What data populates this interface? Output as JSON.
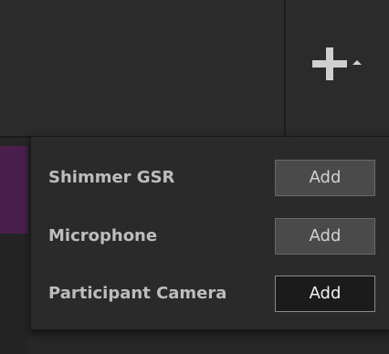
{
  "toolbar": {
    "add_menu_icon": "plus-icon",
    "caret_icon": "caret-up-icon"
  },
  "add_menu": {
    "items": [
      {
        "label": "Shimmer GSR",
        "button_label": "Add",
        "enabled": false
      },
      {
        "label": "Microphone",
        "button_label": "Add",
        "enabled": false
      },
      {
        "label": "Participant Camera",
        "button_label": "Add",
        "enabled": true
      }
    ]
  },
  "colors": {
    "background": "#262626",
    "panel": "#2a2a2a",
    "accent_strip": "#4a1f4c",
    "button_disabled": "#4a4a4a",
    "button_enabled": "#1b1b1b"
  }
}
